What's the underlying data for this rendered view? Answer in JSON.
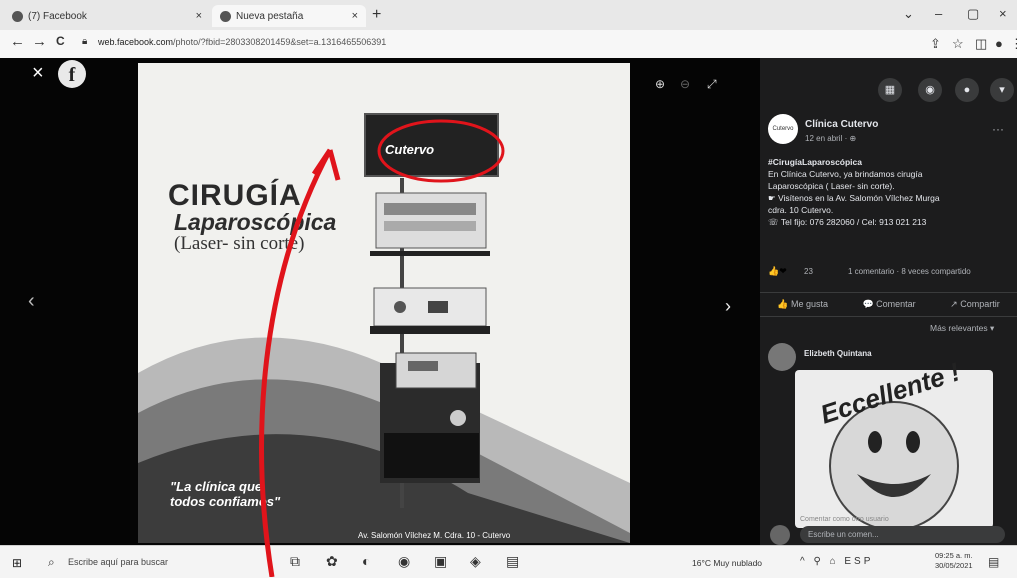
{
  "browser": {
    "tabs": [
      {
        "label": "(7) Facebook",
        "close": "×"
      },
      {
        "label": "Nueva pestaña",
        "close": "×"
      }
    ],
    "new_tab": "+",
    "window_controls": [
      "⌄",
      "–",
      "▢",
      "×"
    ],
    "nav": {
      "back": "←",
      "forward": "→",
      "reload": "C"
    },
    "url_domain": "web.facebook.com",
    "url_rest": "/photo/?fbid=2803308201459&set=a.1316465506391"
  },
  "viewer": {
    "close": "×",
    "logo": "f",
    "prev": "‹",
    "next": "›",
    "tools": [
      "⊕",
      "⊖",
      "⤢"
    ]
  },
  "poster": {
    "title": "CIRUGÍA",
    "subtitle": "Laparoscópica",
    "note": "(Laser- sin corte)",
    "monitor_logo": "Cutervo",
    "quote_line1": "\"La clínica que",
    "quote_line2": "todos confiamos\"",
    "address": "Av. Salomón Vílchez M. Cdra. 10 - Cutervo"
  },
  "panel": {
    "top_icons": [
      "▦",
      "◉",
      "●",
      "▾"
    ],
    "page_name": "Clínica Cutervo",
    "page_avatar": "Cutervo",
    "date": "12 en abril · ⊕",
    "more": "···",
    "post_lines": [
      "#CirugíaLaparoscópica",
      "En Clínica Cutervo, ya brindamos cirugía",
      "Laparoscópica ( Laser- sin corte).",
      "☛ Visítenos en la Av. Salomón Vílchez Murga",
      "cdra. 10 Cutervo.",
      "☏ Tel fijo: 076 282060 / Cel: 913 021 213"
    ],
    "reaction_icons": "👍❤",
    "reaction_count": "23",
    "engagement": "1 comentario · 8 veces compartido",
    "actions": [
      "👍 Me gusta",
      "💬 Comentar",
      "↗ Compartir"
    ],
    "relevance": "Más relevantes ▾",
    "commenter": "Elizbeth Quintana",
    "sticker_text": "Eccellente !",
    "comment_hint": "Comentar como otro usuario",
    "comment_placeholder": "Escribe un comen..."
  },
  "taskbar": {
    "start": "⊞",
    "search_icon": "⌕",
    "search_text": "Escribe aquí para buscar",
    "weather": "16°C Muy nublado",
    "tray": "^ ⚲ ⌂ ESP",
    "time": "09:25 a. m.",
    "date": "30/05/2021",
    "notifications": "▤"
  }
}
